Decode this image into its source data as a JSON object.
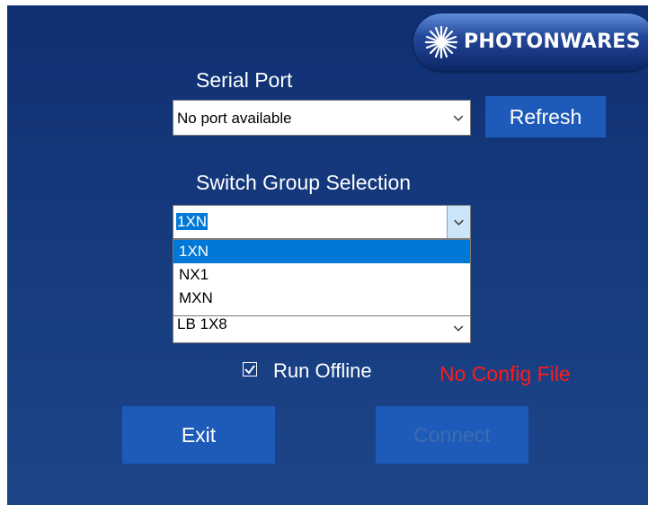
{
  "brand": {
    "logo_text": "PHOTONWARES"
  },
  "serial_port": {
    "label": "Serial Port",
    "selected": "No port available",
    "refresh_label": "Refresh"
  },
  "switch_group": {
    "label": "Switch Group Selection",
    "selected": "1XN",
    "options": [
      "1XN",
      "NX1",
      "MXN"
    ]
  },
  "model": {
    "selected": "LB 1X8"
  },
  "run_offline": {
    "label": "Run Offline",
    "checked": true
  },
  "status": {
    "config_message": "No Config File",
    "color": "#ff1a1a"
  },
  "actions": {
    "exit_label": "Exit",
    "connect_label": "Connect",
    "connect_enabled": false
  },
  "colors": {
    "background": "#163a7e",
    "button": "#1d5ab9",
    "selection": "#0078d7"
  }
}
